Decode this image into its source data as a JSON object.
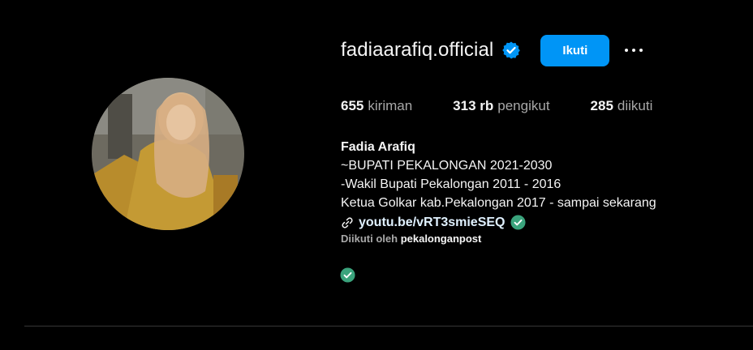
{
  "profile": {
    "username": "fadiaarafiq.official",
    "follow_label": "Ikuti",
    "stats": [
      {
        "num": "655",
        "label": "kiriman"
      },
      {
        "num": "313 rb",
        "label": "pengikut"
      },
      {
        "num": "285",
        "label": "diikuti"
      }
    ],
    "display_name": "Fadia Arafiq",
    "bio_lines": [
      "~BUPATI PEKALONGAN 2021-2030",
      "-Wakil Bupati Pekalongan 2011 - 2016",
      "Ketua Golkar kab.Pekalongan 2017 - sampai sekarang"
    ],
    "link": "youtu.be/vRT3smieSEQ",
    "followed_by_prefix": "Diikuti oleh",
    "followed_by_account": "pekalonganpost"
  },
  "icons": {
    "verified": "verified-badge-icon",
    "more": "more-options-icon",
    "link": "link-icon",
    "check": "check-circle-icon"
  },
  "colors": {
    "background": "#000000",
    "follow_button": "#0095f6",
    "verified": "#0095f6",
    "check_badge": "#3aa37c",
    "secondary_text": "#a8a8a8"
  }
}
